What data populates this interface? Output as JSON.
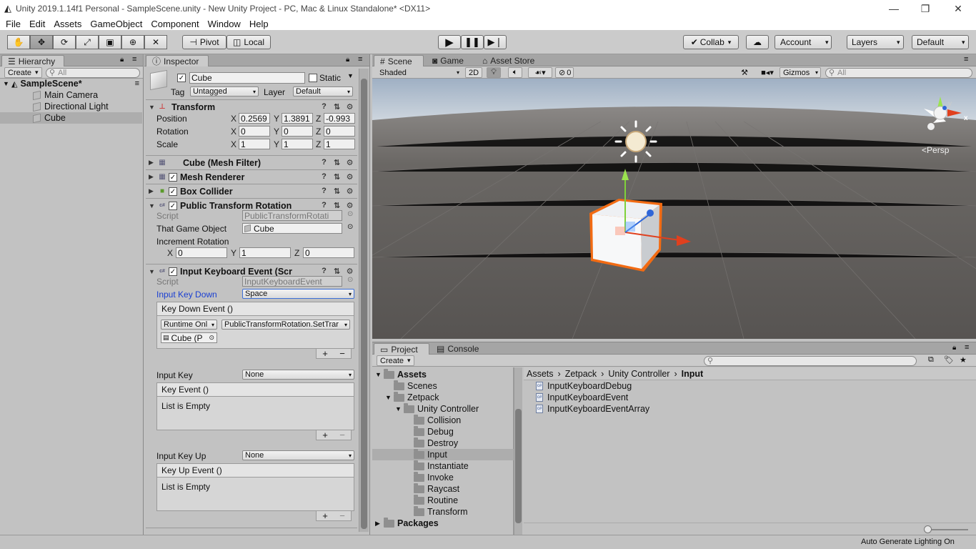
{
  "window": {
    "title": "Unity 2019.1.14f1 Personal - SampleScene.unity - New Unity Project - PC, Mac & Linux Standalone* <DX11>"
  },
  "menu": [
    "File",
    "Edit",
    "Assets",
    "GameObject",
    "Component",
    "Window",
    "Help"
  ],
  "toolbar": {
    "pivot": "Pivot",
    "local": "Local",
    "collab": "Collab",
    "account": "Account",
    "layers": "Layers",
    "layout": "Default"
  },
  "hierarchy": {
    "tab": "Hierarchy",
    "create": "Create",
    "search_placeholder": "All",
    "scene": "SampleScene*",
    "items": [
      "Main Camera",
      "Directional Light",
      "Cube"
    ]
  },
  "inspector": {
    "tab": "Inspector",
    "object_name": "Cube",
    "static_label": "Static",
    "tag_label": "Tag",
    "tag_value": "Untagged",
    "layer_label": "Layer",
    "layer_value": "Default",
    "transform": {
      "title": "Transform",
      "position_label": "Position",
      "rotation_label": "Rotation",
      "scale_label": "Scale",
      "position": [
        "0.2569",
        "1.3891",
        "-0.993"
      ],
      "rotation": [
        "0",
        "0",
        "0"
      ],
      "scale": [
        "1",
        "1",
        "1"
      ]
    },
    "components": [
      "Cube (Mesh Filter)",
      "Mesh Renderer",
      "Box Collider"
    ],
    "ptr": {
      "title": "Public Transform Rotation",
      "script_label": "Script",
      "script_value": "PublicTransformRotati",
      "that_label": "That Game Object",
      "that_value": "Cube",
      "inc_label": "Increment Rotation",
      "inc": [
        "0",
        "1",
        "0"
      ]
    },
    "ike": {
      "title": "Input Keyboard Event (Scr",
      "script_label": "Script",
      "script_value": "InputKeyboardEvent",
      "key_down_label": "Input Key Down",
      "key_down_value": "Space",
      "key_down_event": "Key Down Event ()",
      "runtime": "Runtime Onl",
      "function": "PublicTransformRotation.SetTrar",
      "target": "Cube (P",
      "key_label": "Input Key",
      "key_value": "None",
      "key_event": "Key Event ()",
      "empty1": "List is Empty",
      "key_up_label": "Input Key Up",
      "key_up_value": "None",
      "key_up_event": "Key Up Event ()",
      "empty2": "List is Empty"
    }
  },
  "scene": {
    "tabs": [
      "Scene",
      "Game",
      "Asset Store"
    ],
    "shading": "Shaded",
    "mode2d": "2D",
    "fx_count": "0",
    "gizmos": "Gizmos",
    "search_placeholder": "All",
    "persp": "Persp"
  },
  "project": {
    "tabs": [
      "Project",
      "Console"
    ],
    "create": "Create",
    "tree": [
      {
        "label": "Assets",
        "depth": 0,
        "bold": true
      },
      {
        "label": "Scenes",
        "depth": 1
      },
      {
        "label": "Zetpack",
        "depth": 1
      },
      {
        "label": "Unity Controller",
        "depth": 2
      },
      {
        "label": "Collision",
        "depth": 3
      },
      {
        "label": "Debug",
        "depth": 3
      },
      {
        "label": "Destroy",
        "depth": 3
      },
      {
        "label": "Input",
        "depth": 3,
        "selected": true
      },
      {
        "label": "Instantiate",
        "depth": 3
      },
      {
        "label": "Invoke",
        "depth": 3
      },
      {
        "label": "Raycast",
        "depth": 3
      },
      {
        "label": "Routine",
        "depth": 3
      },
      {
        "label": "Transform",
        "depth": 3
      },
      {
        "label": "Packages",
        "depth": 0,
        "bold": true
      }
    ],
    "breadcrumb": [
      "Assets",
      "Zetpack",
      "Unity Controller",
      "Input"
    ],
    "files": [
      "InputKeyboardDebug",
      "InputKeyboardEvent",
      "InputKeyboardEventArray"
    ]
  },
  "status": {
    "text": "Auto Generate Lighting On"
  },
  "colors": {
    "selection_orange": "#f26b13",
    "sky": "#c9d3dd",
    "ground": "#5c5a58"
  }
}
